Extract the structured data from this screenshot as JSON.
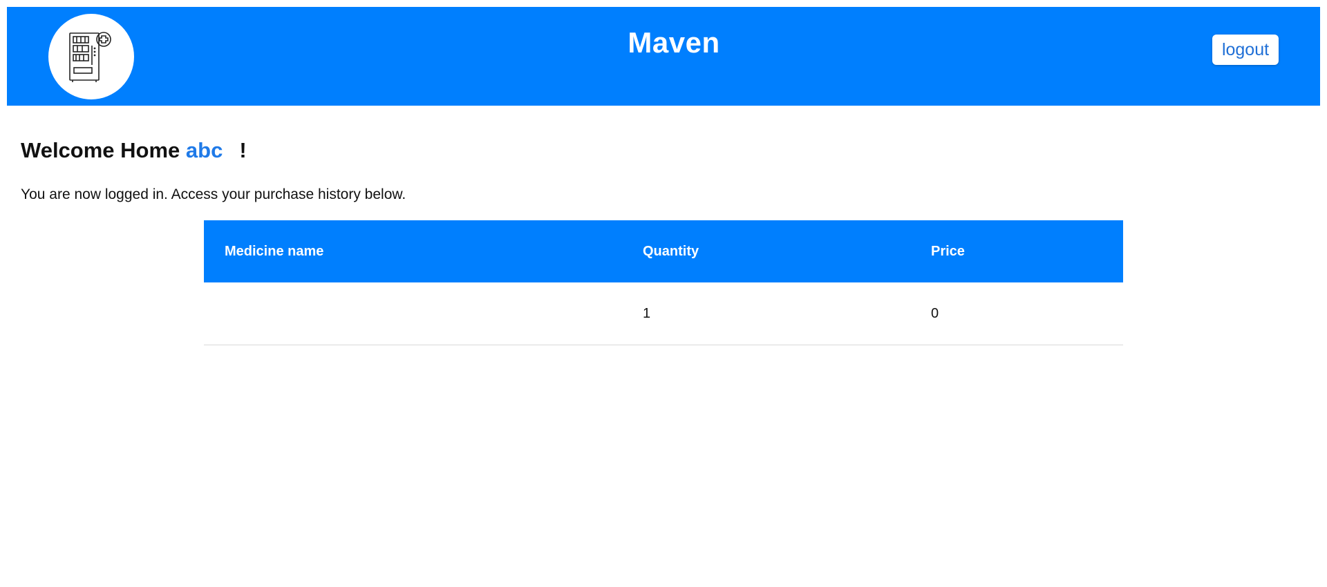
{
  "header": {
    "brand_title": "Maven",
    "logo_icon": "vending-machine-medical-icon",
    "logout_label": "logout",
    "background_color": "#007ffe"
  },
  "welcome": {
    "greeting": "Welcome Home",
    "username": "abc",
    "exclamation": "!",
    "username_color": "#1f7ae8",
    "subtext": "You are now logged in. Access your purchase history below."
  },
  "purchase_table": {
    "columns": [
      "Medicine name",
      "Quantity",
      "Price"
    ],
    "rows": [
      {
        "medicine_name": "",
        "quantity": "1",
        "price": "0"
      }
    ]
  }
}
